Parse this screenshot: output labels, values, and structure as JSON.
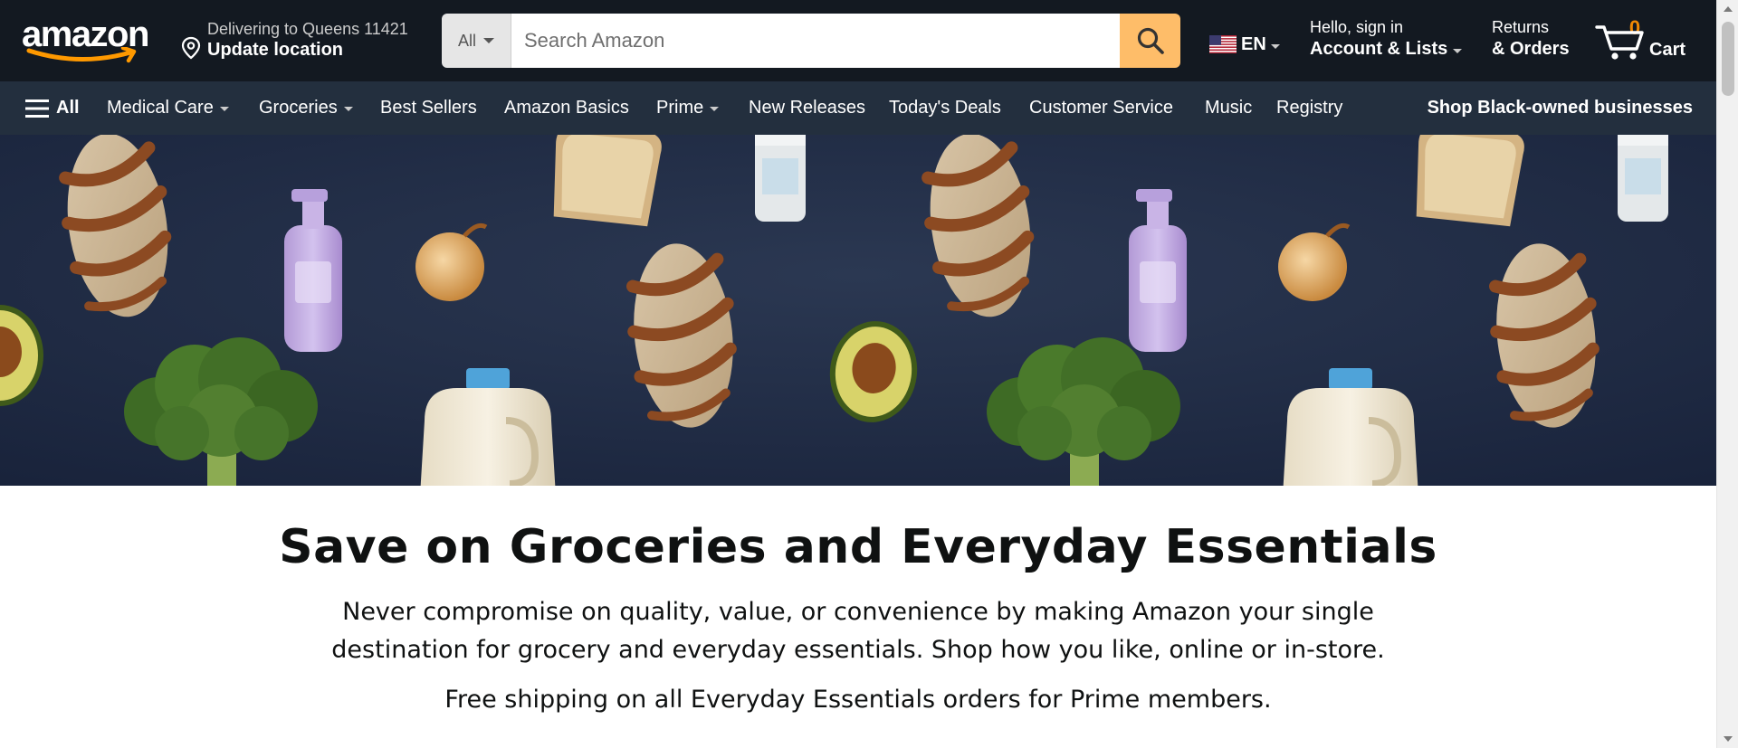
{
  "brand": {
    "logo_text": "amazon",
    "logo_color": "#ffffff",
    "smile_color": "#ff9900"
  },
  "colors": {
    "nav_top": "#131921",
    "nav_sub": "#232f3e",
    "search_button": "#febd69",
    "cart_count": "#f08804",
    "hero_bg": "#1f2a3d"
  },
  "delivery": {
    "line1": "Delivering to Queens 11421",
    "line2": "Update location",
    "icon": "location-pin-icon"
  },
  "search": {
    "category": "All",
    "placeholder": "Search Amazon",
    "value": "",
    "button_icon": "search-icon"
  },
  "language": {
    "code": "EN",
    "flag_icon": "us-flag-icon"
  },
  "account": {
    "greeting": "Hello, sign in",
    "label": "Account & Lists"
  },
  "orders": {
    "line1": "Returns",
    "line2": "& Orders"
  },
  "cart": {
    "count": "0",
    "label": "Cart",
    "icon": "cart-icon"
  },
  "subnav": {
    "all_label": "All",
    "items": [
      {
        "label": "Medical Care",
        "has_dropdown": true
      },
      {
        "label": "Groceries",
        "has_dropdown": true
      },
      {
        "label": "Best Sellers",
        "has_dropdown": false
      },
      {
        "label": "Amazon Basics",
        "has_dropdown": false
      },
      {
        "label": "Prime",
        "has_dropdown": true
      },
      {
        "label": "New Releases",
        "has_dropdown": false
      },
      {
        "label": "Today's Deals",
        "has_dropdown": false
      },
      {
        "label": "Customer Service",
        "has_dropdown": false
      },
      {
        "label": "Music",
        "has_dropdown": false
      },
      {
        "label": "Registry",
        "has_dropdown": false
      }
    ],
    "promo": "Shop Black-owned businesses"
  },
  "hero": {
    "items": [
      "bread-loaf",
      "shampoo-bottle",
      "onion",
      "sliced-bread",
      "deodorant",
      "avocado",
      "broccoli",
      "milk-jug"
    ]
  },
  "content": {
    "title": "Save on Groceries and Everyday Essentials",
    "description": "Never compromise on quality, value, or convenience by making Amazon your single destination for grocery and everyday essentials. Shop how you like, online or in-store.",
    "shipping": "Free shipping on all Everyday Essentials orders for Prime members."
  }
}
